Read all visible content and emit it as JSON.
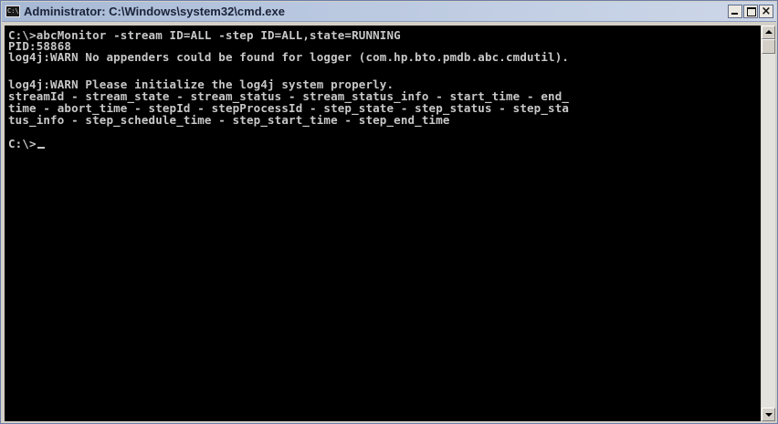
{
  "window": {
    "title": "Administrator: C:\\Windows\\system32\\cmd.exe",
    "icon_label": "C:\\",
    "controls": {
      "minimize": "minimize-icon",
      "maximize": "maximize-icon",
      "close": "×"
    }
  },
  "console": {
    "lines": [
      "C:\\>abcMonitor -stream ID=ALL -step ID=ALL,state=RUNNING",
      "PID:58868",
      "log4j:WARN No appenders could be found for logger (com.hp.bto.pmdb.abc.cmdutil).",
      "",
      "log4j:WARN Please initialize the log4j system properly.",
      "streamId - stream_state - stream_status - stream_status_info - start_time - end_",
      "time - abort_time - stepId - stepProcessId - step_state - step_status - step_sta",
      "tus_info - step_schedule_time - step_start_time - step_end_time",
      "",
      "C:\\>"
    ]
  },
  "colors": {
    "console_background": "#000000",
    "console_text": "#c8c8c8",
    "titlebar": "#b7c6df"
  }
}
